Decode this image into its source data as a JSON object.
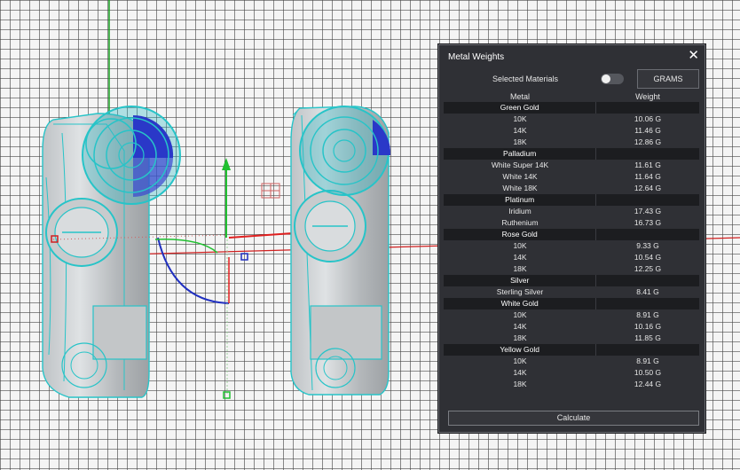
{
  "panel": {
    "title": "Metal Weights",
    "close_icon": "close-icon",
    "selected_materials_label": "Selected Materials",
    "toggle_on": false,
    "units_button": "GRAMS",
    "header_metal": "Metal",
    "header_weight": "Weight",
    "calculate_label": "Calculate"
  },
  "groups": [
    {
      "name": "Green Gold",
      "items": [
        {
          "metal": "10K",
          "weight": "10.06 G"
        },
        {
          "metal": "14K",
          "weight": "11.46 G"
        },
        {
          "metal": "18K",
          "weight": "12.86 G"
        }
      ]
    },
    {
      "name": "Palladium",
      "items": [
        {
          "metal": "White Super 14K",
          "weight": "11.61 G"
        },
        {
          "metal": "White 14K",
          "weight": "11.64 G"
        },
        {
          "metal": "White 18K",
          "weight": "12.64 G"
        }
      ]
    },
    {
      "name": "Platinum",
      "items": [
        {
          "metal": "Iridium",
          "weight": "17.43 G"
        },
        {
          "metal": "Ruthenium",
          "weight": "16.73 G"
        }
      ]
    },
    {
      "name": "Rose Gold",
      "items": [
        {
          "metal": "10K",
          "weight": "9.33 G"
        },
        {
          "metal": "14K",
          "weight": "10.54 G"
        },
        {
          "metal": "18K",
          "weight": "12.25 G"
        }
      ]
    },
    {
      "name": "Silver",
      "items": [
        {
          "metal": "Sterling Silver",
          "weight": "8.41 G"
        }
      ]
    },
    {
      "name": "White Gold",
      "items": [
        {
          "metal": "10K",
          "weight": "8.91 G"
        },
        {
          "metal": "14K",
          "weight": "10.16 G"
        },
        {
          "metal": "18K",
          "weight": "11.85 G"
        }
      ]
    },
    {
      "name": "Yellow Gold",
      "items": [
        {
          "metal": "10K",
          "weight": "8.91 G"
        },
        {
          "metal": "14K",
          "weight": "10.50 G"
        },
        {
          "metal": "18K",
          "weight": "12.44 G"
        }
      ]
    }
  ],
  "colors": {
    "panel_bg": "#2f3035",
    "group_bg": "#1c1d20",
    "wire": "#27c4c8",
    "axis_x": "#e02020",
    "axis_y": "#20c030",
    "axis_z": "#2030c0"
  }
}
